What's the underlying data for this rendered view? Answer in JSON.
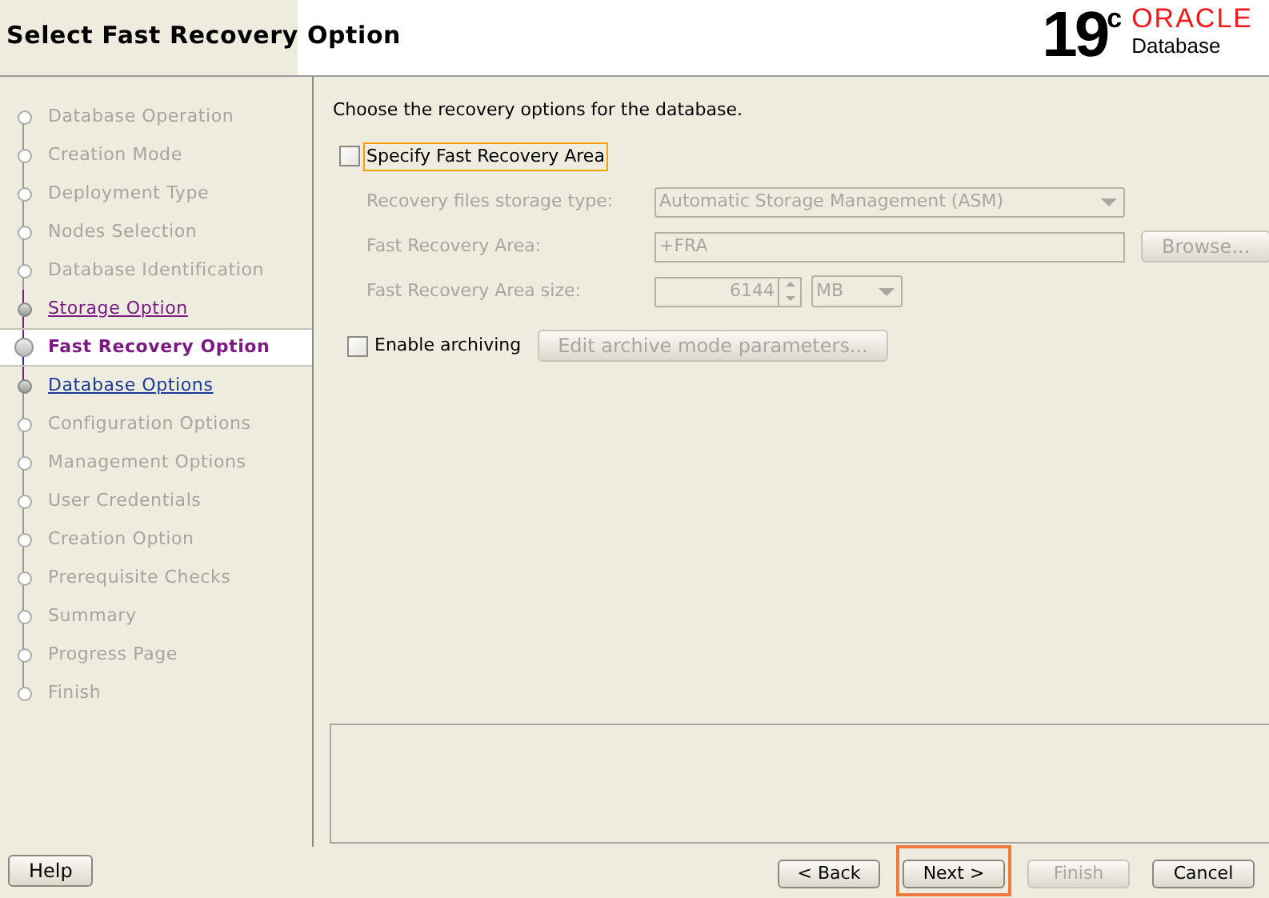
{
  "header": {
    "title": "Select Fast Recovery Option",
    "logo_version": "19",
    "logo_superscript": "c",
    "logo_brand": "ORACLE",
    "logo_product": "Database"
  },
  "steps": [
    {
      "label": "Database Operation",
      "kind": "pending"
    },
    {
      "label": "Creation Mode",
      "kind": "pending"
    },
    {
      "label": "Deployment Type",
      "kind": "pending"
    },
    {
      "label": "Nodes Selection",
      "kind": "pending"
    },
    {
      "label": "Database Identification",
      "kind": "pending"
    },
    {
      "label": "Storage Option",
      "kind": "done"
    },
    {
      "label": "Fast Recovery Option",
      "kind": "current"
    },
    {
      "label": "Database Options",
      "kind": "next"
    },
    {
      "label": "Configuration Options",
      "kind": "pending"
    },
    {
      "label": "Management Options",
      "kind": "pending"
    },
    {
      "label": "User Credentials",
      "kind": "pending"
    },
    {
      "label": "Creation Option",
      "kind": "pending"
    },
    {
      "label": "Prerequisite Checks",
      "kind": "pending"
    },
    {
      "label": "Summary",
      "kind": "pending"
    },
    {
      "label": "Progress Page",
      "kind": "pending"
    },
    {
      "label": "Finish",
      "kind": "pending"
    }
  ],
  "content": {
    "intro": "Choose the recovery options for the database.",
    "specify_fra": {
      "label": "Specify Fast Recovery Area",
      "checked": false,
      "focused": true
    },
    "storage_type": {
      "label": "Recovery files storage type:",
      "value": "Automatic Storage Management (ASM)",
      "disabled": true
    },
    "fra": {
      "label": "Fast Recovery Area:",
      "value": "+FRA",
      "browse": "Browse...",
      "disabled": true
    },
    "fra_size": {
      "label": "Fast Recovery Area size:",
      "value": "6144",
      "unit": "MB",
      "disabled": true
    },
    "archiving": {
      "label": "Enable archiving",
      "checked": false,
      "edit_button": "Edit archive mode parameters...",
      "edit_disabled": true
    }
  },
  "buttons": {
    "help": {
      "label": "Help",
      "disabled": false
    },
    "nav": [
      {
        "label": "< Back",
        "disabled": false,
        "highlighted": false
      },
      {
        "label": "Next >",
        "disabled": false,
        "highlighted": true
      },
      {
        "label": "Finish",
        "disabled": true,
        "highlighted": false
      },
      {
        "label": "Cancel",
        "disabled": false,
        "highlighted": false
      }
    ]
  }
}
